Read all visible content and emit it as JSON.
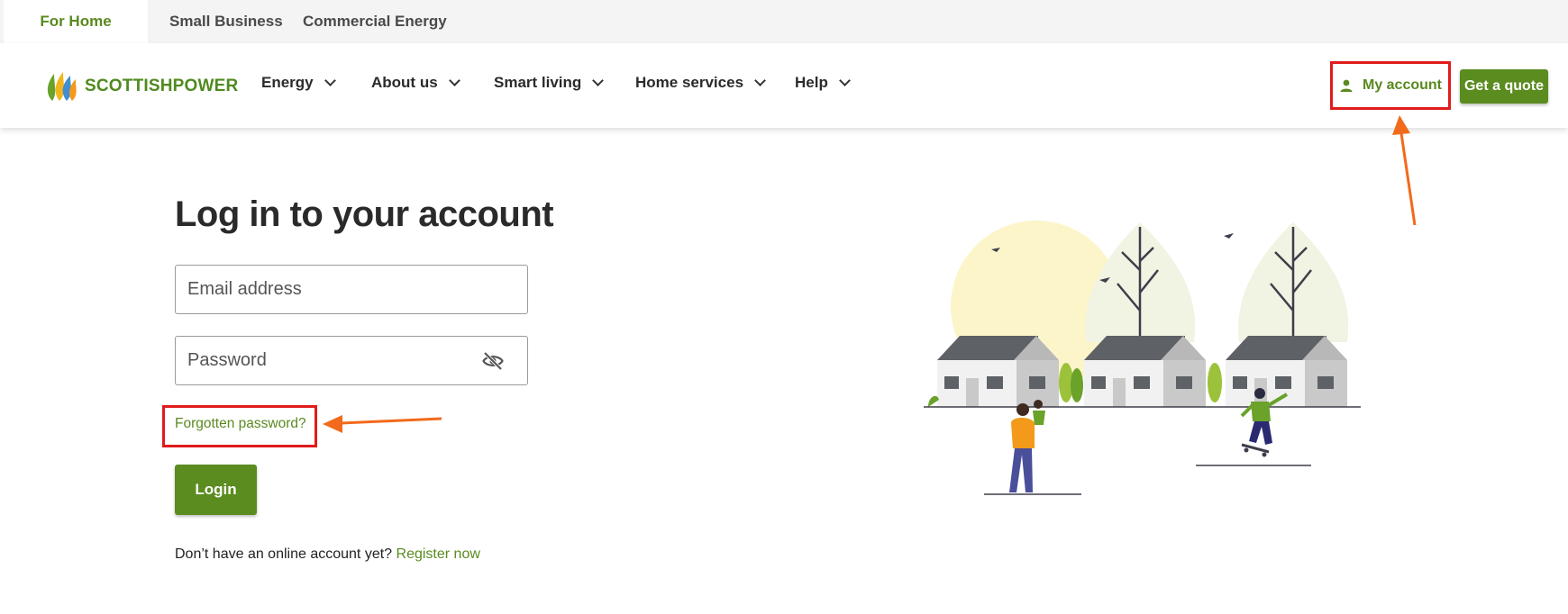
{
  "top_tabs": [
    {
      "label": "For Home",
      "active": true
    },
    {
      "label": "Small Business",
      "active": false
    },
    {
      "label": "Commercial Energy",
      "active": false
    }
  ],
  "brand": {
    "name": "SCOTTISHPOWER",
    "accent": "#5b8c1f"
  },
  "nav": {
    "items": [
      {
        "label": "Energy"
      },
      {
        "label": "About us"
      },
      {
        "label": "Smart living"
      },
      {
        "label": "Home services"
      },
      {
        "label": "Help"
      }
    ],
    "my_account": "My account",
    "get_quote": "Get a quote"
  },
  "login": {
    "title": "Log in to your account",
    "email_placeholder": "Email address",
    "password_placeholder": "Password",
    "forgot": "Forgotten password?",
    "submit": "Login",
    "register_prompt": "Don’t have an online account yet?",
    "register_link": "Register now"
  },
  "annotations": {
    "highlight_color": "#e01b1b",
    "arrow_color": "#f26a1b"
  },
  "icons": [
    "user-icon",
    "eye-slash-icon",
    "chevron-down-icon"
  ]
}
